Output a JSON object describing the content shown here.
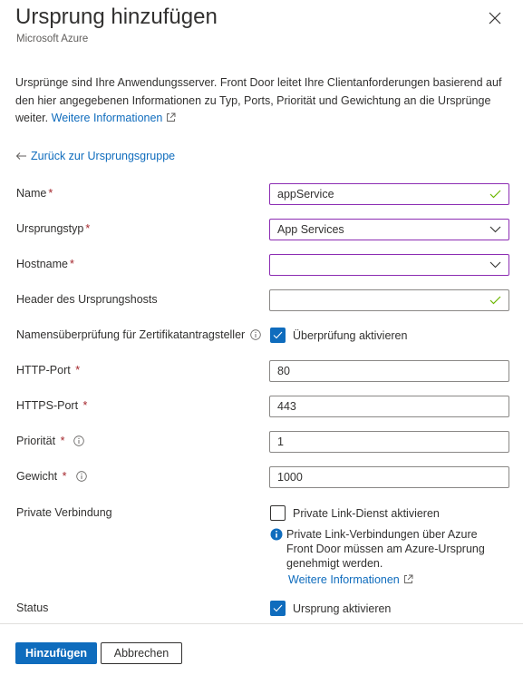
{
  "header": {
    "title": "Ursprung hinzufügen",
    "subtitle": "Microsoft Azure",
    "close_icon": "close-icon"
  },
  "description": {
    "text": "Ursprünge sind Ihre Anwendungsserver. Front Door leitet Ihre Clientanforderungen basierend auf den hier angegebenen Informationen zu Typ, Ports, Priorität und Gewichtung an die Ursprünge weiter.",
    "link": "Weitere Informationen"
  },
  "back_link": {
    "label": "Zurück zur Ursprungsgruppe",
    "icon": "arrow-left-icon"
  },
  "form": {
    "name": {
      "label": "Name",
      "required": "*",
      "value": "appService",
      "valid": true
    },
    "origin_type": {
      "label": "Ursprungstyp",
      "required": "*",
      "value": "App Services"
    },
    "hostname": {
      "label": "Hostname",
      "required": "*",
      "value": ""
    },
    "host_header": {
      "label": "Header des Ursprungshosts",
      "value": "",
      "valid": true
    },
    "cert_check": {
      "label": "Namensüberprüfung für Zertifikatantragsteller",
      "checkbox_label": "Überprüfung aktivieren",
      "checked": true
    },
    "http_port": {
      "label": "HTTP-Port",
      "required": "*",
      "value": "80"
    },
    "https_port": {
      "label": "HTTPS-Port",
      "required": "*",
      "value": "443"
    },
    "priority": {
      "label": "Priorität",
      "required": "*",
      "value": "1"
    },
    "weight": {
      "label": "Gewicht",
      "required": "*",
      "value": "1000"
    },
    "private_link": {
      "label": "Private Verbindung",
      "checkbox_label": "Private Link-Dienst aktivieren",
      "checked": false,
      "note": "Private Link-Verbindungen über Azure Front Door müssen am Azure-Ursprung genehmigt werden.",
      "note_link": "Weitere Informationen"
    },
    "status": {
      "label": "Status",
      "checkbox_label": "Ursprung aktivieren",
      "checked": true
    }
  },
  "footer": {
    "primary_label": "Hinzufügen",
    "secondary_label": "Abbrechen"
  },
  "colors": {
    "accent": "#0f6cbd",
    "focus_border": "#8c2db3",
    "required": "#a4262c",
    "valid_check": "#6bb700"
  }
}
